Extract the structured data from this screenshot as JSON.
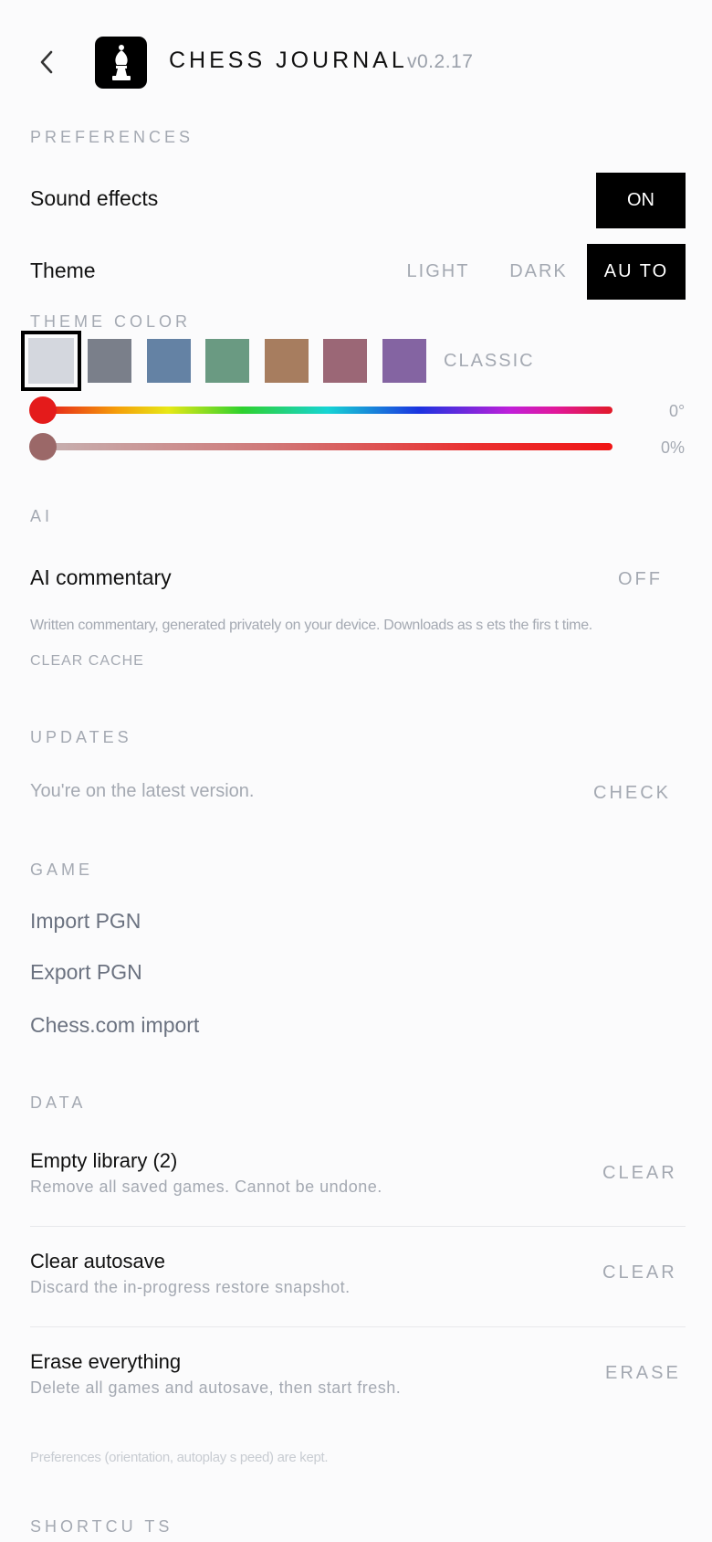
{
  "header": {
    "back_icon": "chevron-left-icon",
    "logo_icon": "chess-bishop-icon",
    "title": "CHESS JOURNAL",
    "version": "v0.2.17"
  },
  "preferences": {
    "label": "PREFERENCES",
    "sound": {
      "label": "Sound effects",
      "value": "ON"
    },
    "theme": {
      "label": "Theme",
      "options": [
        "LIGHT",
        "DARK",
        "AU TO"
      ],
      "selected": "AU TO"
    },
    "theme_color": {
      "label": "THEME COLOR",
      "swatches": [
        "#d4d7de",
        "#7a7f8a",
        "#6482a4",
        "#6a9a82",
        "#a77d5f",
        "#9b6776",
        "#8464a2"
      ],
      "selected_name": "CLASSIC",
      "hue": {
        "value": "0°",
        "fraction": 0
      },
      "saturation": {
        "value": "0%",
        "fraction": 0
      }
    }
  },
  "ai": {
    "label": "AI",
    "commentary": {
      "label": "AI commentary",
      "value": "OFF"
    },
    "hint": "Written commentary, generated privately on your device. Downloads  as s ets  the firs t time.",
    "clear_cache": "CLEAR CACHE"
  },
  "updates": {
    "label": "UPDATES",
    "status": "You're on the latest version.",
    "action": "CHECK"
  },
  "game": {
    "label": "GAME",
    "items": [
      "Import PGN",
      "Export PGN",
      "Chess.com import"
    ]
  },
  "data": {
    "label": "DATA",
    "rows": [
      {
        "title": "Empty library (2)",
        "desc": "Remove all saved games. Cannot be undone.",
        "action": "CLEAR"
      },
      {
        "title": "Clear autosave",
        "desc": "Discard the in-progress restore snapshot.",
        "action": "CLEAR"
      },
      {
        "title": "Erase everything",
        "desc": "Delete all games and autosave, then start fresh.",
        "action": "ERASE"
      }
    ],
    "footnote": "Preferences  (orientation, autoplay s peed) are kept."
  },
  "shortcuts": {
    "label": "SHORTCU TS"
  },
  "colors": {
    "accent": "#000000",
    "muted": "#a4a9b2",
    "hue_thumb": "#e41b1b",
    "sat_thumb": "#9b6868"
  }
}
